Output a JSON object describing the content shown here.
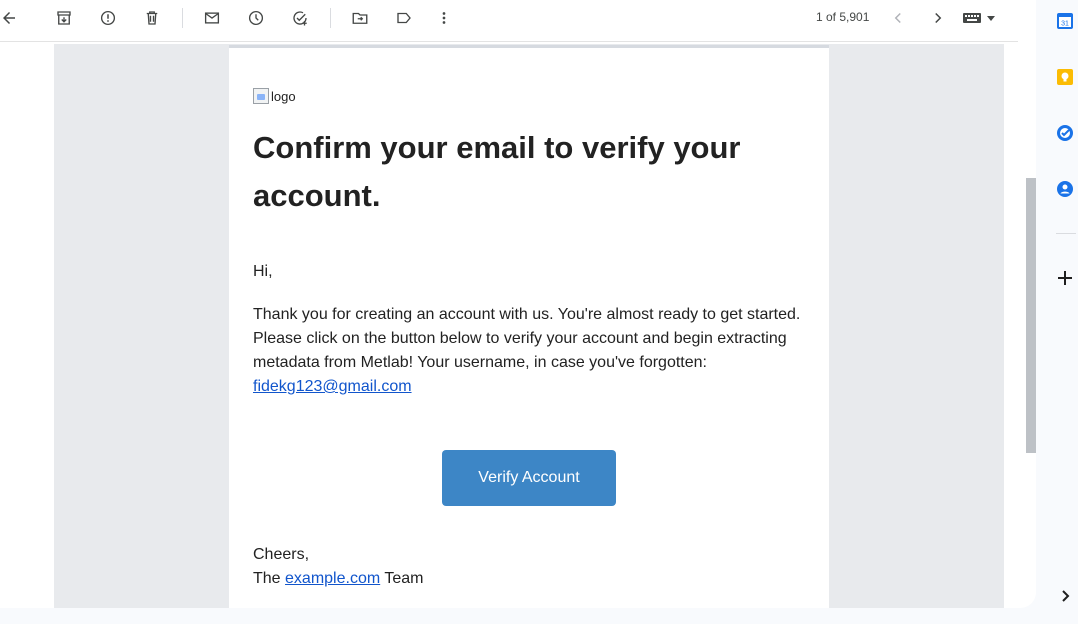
{
  "toolbar": {
    "pager_text": "1 of 5,901"
  },
  "email": {
    "logo_alt": "logo",
    "headline": "Confirm your email to verify your account.",
    "greeting": "Hi,",
    "body": "Thank you for creating an account with us. You're almost ready to get started. Please click on the button below to verify your account and begin extracting metadata from Metlab! Your username, in case you've forgotten:",
    "username_link": "fidekg123@gmail.com",
    "verify_button": "Verify Account",
    "signoff": "Cheers,",
    "team_prefix": "The",
    "team_link": "example.com",
    "team_suffix": "Team"
  },
  "side_panel": {
    "calendar_day": "31"
  },
  "colors": {
    "button": "#3d86c6",
    "link": "#1155cc",
    "calendar_blue": "#1a73e8",
    "keep_yellow": "#fbbc04",
    "tasks_blue": "#1a73e8",
    "contacts_blue": "#1a73e8"
  },
  "icons": [
    "back-arrow-icon",
    "archive-icon",
    "report-spam-icon",
    "delete-icon",
    "mark-unread-icon",
    "snooze-icon",
    "add-to-tasks-icon",
    "move-to-icon",
    "label-icon",
    "more-vert-icon",
    "chevron-left-icon",
    "chevron-right-icon",
    "keyboard-icon",
    "calendar-icon",
    "keep-icon",
    "tasks-icon",
    "contacts-icon",
    "add-icon",
    "expand-panel-icon"
  ]
}
